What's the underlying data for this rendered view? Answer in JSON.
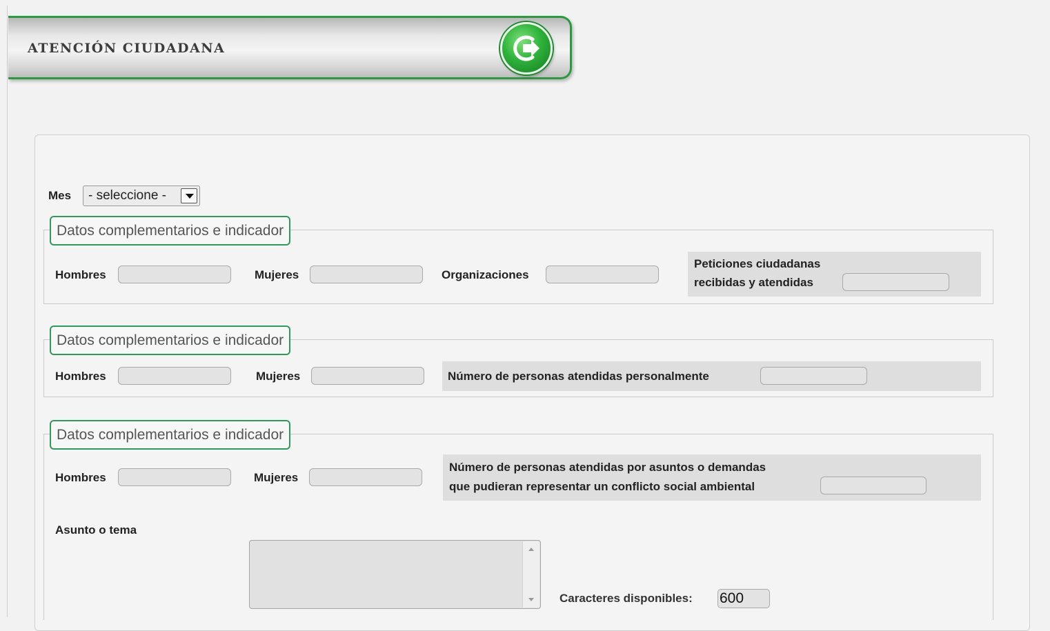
{
  "header": {
    "title": "ATENCIÓN CIUDADANA",
    "exit_icon": "exit-arrow-icon",
    "accent": "#2a9a3e"
  },
  "mes": {
    "label": "Mes",
    "selected": "- seleccione -"
  },
  "section1": {
    "legend": "Datos complementarios e indicador",
    "hombres_label": "Hombres",
    "mujeres_label": "Mujeres",
    "organizaciones_label": "Organizaciones",
    "peticiones_label_line1": "Peticiones ciudadanas",
    "peticiones_label_line2": "recibidas y atendidas"
  },
  "section2": {
    "legend": "Datos complementarios e indicador",
    "hombres_label": "Hombres",
    "mujeres_label": "Mujeres",
    "personas_label": "Número de personas atendidas personalmente"
  },
  "section3": {
    "legend": "Datos complementarios e indicador",
    "hombres_label": "Hombres",
    "mujeres_label": "Mujeres",
    "conflicto_label_line1": "Número de personas atendidas por asuntos o demandas",
    "conflicto_label_line2": "que pudieran representar un conflicto social ambiental",
    "asunto_label": "Asunto o tema",
    "chars_label": "Caracteres disponibles:",
    "chars_value": "600"
  }
}
